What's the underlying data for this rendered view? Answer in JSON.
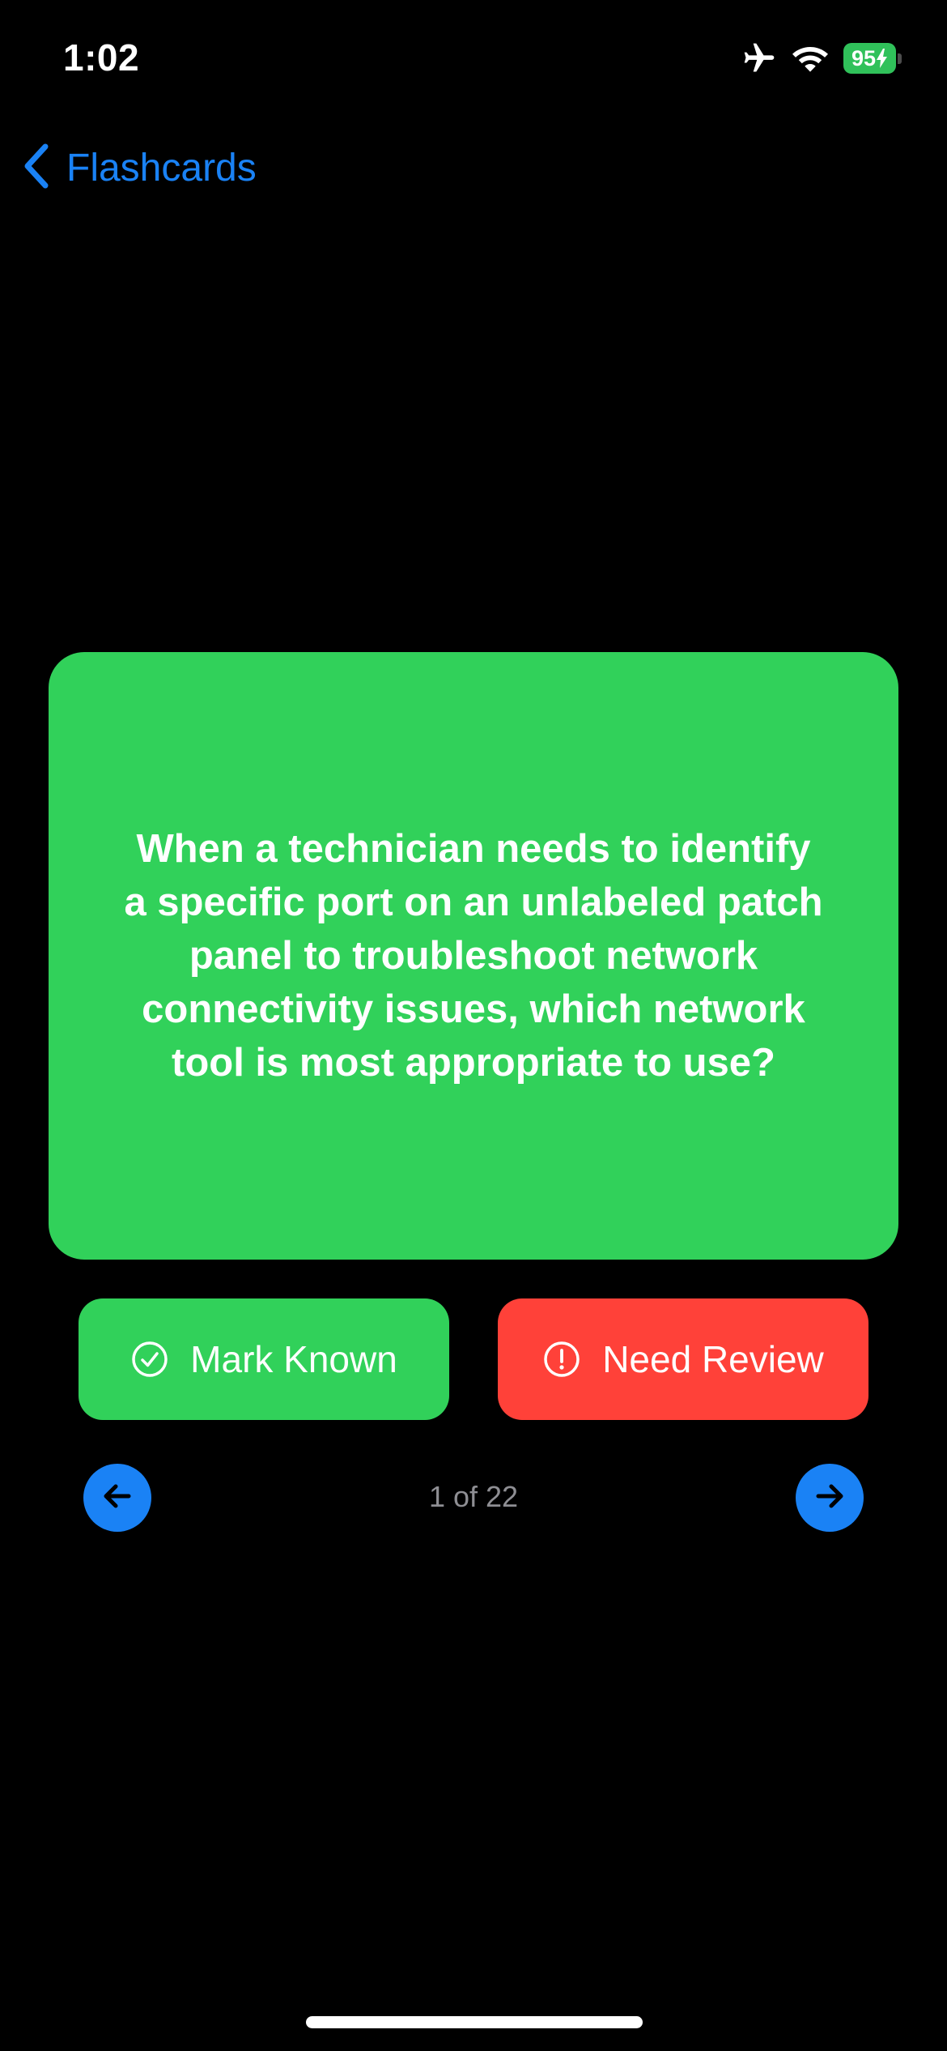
{
  "status_bar": {
    "time": "1:02",
    "battery_percent": "95",
    "icons": [
      "airplane-icon",
      "wifi-icon",
      "battery-charging-icon"
    ]
  },
  "nav": {
    "back_label": "Flashcards",
    "back_icon": "chevron-left-icon"
  },
  "card": {
    "question": "When a technician needs to identify a specific port on an unlabeled patch panel to troubleshoot network connectivity issues, which network tool is most appropriate to use?"
  },
  "actions": {
    "known_label": "Mark Known",
    "known_icon": "checkmark-circle-icon",
    "review_label": "Need Review",
    "review_icon": "exclamation-circle-icon"
  },
  "pager": {
    "count_text": "1 of 22",
    "prev_icon": "arrow-left-icon",
    "next_icon": "arrow-right-icon"
  },
  "colors": {
    "background": "#000000",
    "accent_blue": "#1a82f5",
    "card_green": "#31d15a",
    "review_red": "#ff4139",
    "muted_text": "#8e8e93"
  }
}
